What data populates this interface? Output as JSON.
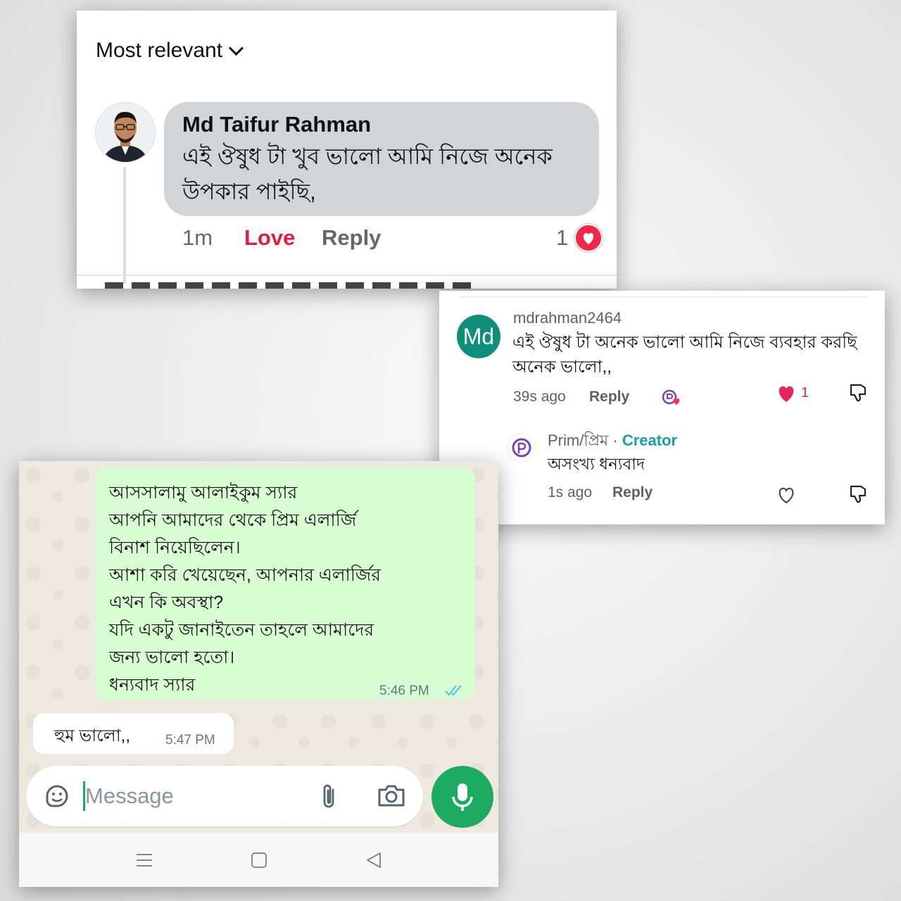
{
  "facebook": {
    "sort_label": "Most relevant",
    "comment": {
      "author": "Md Taifur Rahman",
      "text": "এই ঔষুধ টা খুব ভালো আমি নিজে অনেক উপকার পাইছি,",
      "time": "1m",
      "reaction_label": "Love",
      "reply_label": "Reply",
      "reaction_count": "1"
    }
  },
  "youtube": {
    "comment": {
      "avatar_initials": "Md",
      "username": "mdrahman2464",
      "text": "এই ঔষুধ টা অনেক ভালো আমি নিজে ব্যবহার করছি অনেক ভালো,,",
      "time": "39s ago",
      "reply_label": "Reply",
      "like_count": "1"
    },
    "reply": {
      "username": "Prim/প্রিম",
      "separator": "·",
      "badge": "Creator",
      "text": "অসংখ্য ধন্যবাদ",
      "time": "1s ago",
      "reply_label": "Reply"
    }
  },
  "whatsapp": {
    "outgoing": {
      "lines": [
        "আসসালামু আলাইকুম স্যার",
        "আপনি আমাদের থেকে প্রিম এলার্জি",
        "বিনাশ নিয়েছিলেন।",
        "আশা করি খেয়েছেন, আপনার এলার্জির",
        "এখন কি অবস্থা?",
        "যদি একটু জানাইতেন তাহলে আমাদের",
        "জন্য ভালো হতো।",
        "ধন্যবাদ স্যার"
      ],
      "time": "5:46 PM",
      "status": "read"
    },
    "incoming": {
      "text": "হুম ভালো,,",
      "time": "5:47 PM"
    },
    "input_placeholder": "Message",
    "accent_color": "#1daa61"
  }
}
